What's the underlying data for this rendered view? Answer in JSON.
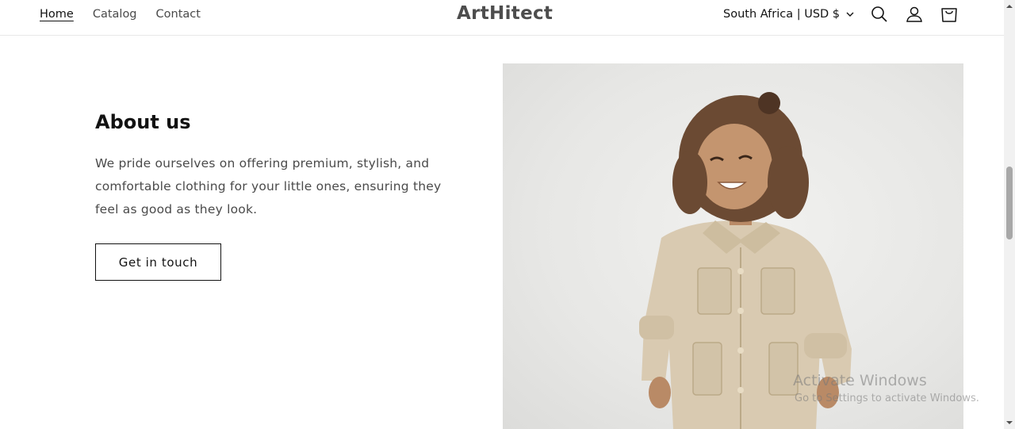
{
  "header": {
    "nav": [
      {
        "label": "Home",
        "active": true
      },
      {
        "label": "Catalog",
        "active": false
      },
      {
        "label": "Contact",
        "active": false
      }
    ],
    "logo": "ArtHitect",
    "locale": "South Africa | USD $",
    "icons": [
      "search-icon",
      "account-icon",
      "cart-icon"
    ]
  },
  "about": {
    "title": "About us",
    "text": "We pride ourselves on offering premium, stylish, and comfortable clothing for your little ones, ensuring they feel as good as they look.",
    "button": "Get in touch"
  },
  "watermark": {
    "title": "Activate Windows",
    "subtitle": "Go to Settings to activate Windows."
  },
  "colors": {
    "text": "#121212",
    "muted": "#4a4a4a",
    "logo": "#4d4d4d",
    "photo_bg": "#e9e9e7",
    "jacket": "#d8c9b0"
  }
}
